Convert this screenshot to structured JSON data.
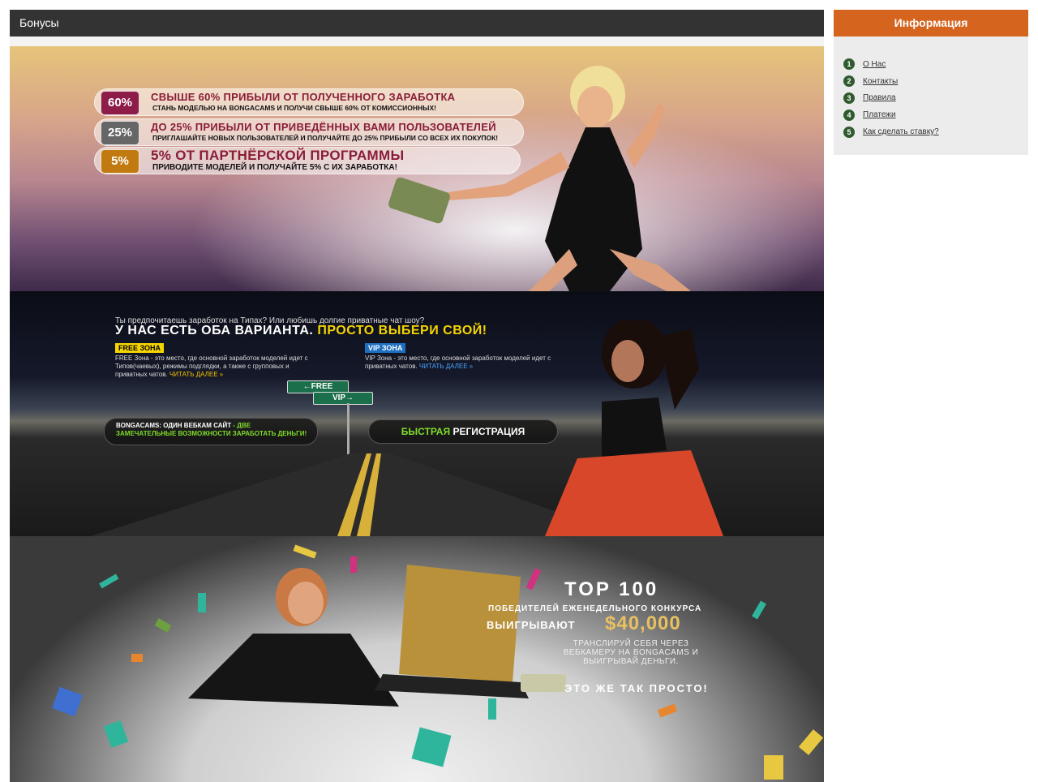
{
  "main": {
    "title": "Бонусы"
  },
  "banner1": {
    "rows": [
      {
        "badge": "60%",
        "color": "#8d1d48",
        "title": "СВЫШЕ 60% ПРИБЫЛИ ОТ ПОЛУЧЕННОГО ЗАРАБОТКА",
        "subtitle": "СТАНЬ МОДЕЛЬЮ НА BONGACAMS И ПОЛУЧИ СВЫШЕ 60% ОТ КОМИССИОННЫХ!"
      },
      {
        "badge": "25%",
        "color": "#666666",
        "title": "ДО 25% ПРИБЫЛИ ОТ ПРИВЕДЁННЫХ ВАМИ ПОЛЬЗОВАТЕЛЕЙ",
        "subtitle": "ПРИГЛАШАЙТЕ НОВЫХ ПОЛЬЗОВАТЕЛЕЙ И ПОЛУЧАЙТЕ ДО 25% ПРИБЫЛИ СО ВСЕХ ИХ ПОКУПОК!"
      },
      {
        "badge": "5%",
        "color": "#c07a10",
        "title": "5% ОТ ПАРТНЁРСКОЙ ПРОГРАММЫ",
        "subtitle": "ПРИВОДИТЕ МОДЕЛЕЙ И ПОЛУЧАЙТЕ 5% С ИХ ЗАРАБОТКА!"
      }
    ]
  },
  "banner2": {
    "question": "Ты предпочитаешь заработок на Типах? Или любишь долгие приватные чат шоу?",
    "headline_white": "У НАС ЕСТЬ ОБА ВАРИАНТА.",
    "headline_yellow": "ПРОСТО ВЫБЕРИ СВОЙ!",
    "free_tag": "FREE ЗОНА",
    "free_text": "FREE Зона - это место, где основной заработок моделей идет с Типов(чаевых), режимы подглядки, а также с групповых и приватных чатов.",
    "free_link": "ЧИТАТЬ ДАЛЕЕ »",
    "vip_tag": "VIP ЗОНА",
    "vip_text": "VIP Зона - это место, где основной заработок моделей идет с приватных чатов.",
    "vip_link": "ЧИТАТЬ ДАЛЕЕ »",
    "sign_free": "←FREE",
    "sign_vip": "VIP→",
    "bottom_white": "BONGACAMS: ОДИН ВЕБКАМ САЙТ",
    "bottom_green": "- ДВЕ ЗАМЕЧАТЕЛЬНЫЕ ВОЗМОЖНОСТИ ЗАРАБОТАТЬ ДЕНЬГИ!",
    "reg_green": "БЫСТРАЯ",
    "reg_white": "РЕГИСТРАЦИЯ"
  },
  "banner3": {
    "title": "TOP 100",
    "subtitle": "ПОБЕДИТЕЛЕЙ ЕЖЕНЕДЕЛЬНОГО КОНКУРСА",
    "win": "ВЫИГРЫВАЮТ",
    "amount": "$40,000",
    "text": "ТРАНСЛИРУЙ СЕБЯ ЧЕРЕЗ ВЕБКАМЕРУ НА BONGACAMS И ВЫИГРЫВАЙ ДЕНЬГИ.",
    "simple": "ЭТО ЖЕ ТАК ПРОСТО!"
  },
  "sidebar": {
    "title": "Информация",
    "items": [
      {
        "num": "1",
        "label": "О Нас"
      },
      {
        "num": "2",
        "label": "Контакты"
      },
      {
        "num": "3",
        "label": "Правила"
      },
      {
        "num": "4",
        "label": "Платежи"
      },
      {
        "num": "5",
        "label": "Как сделать ставку?"
      }
    ]
  }
}
